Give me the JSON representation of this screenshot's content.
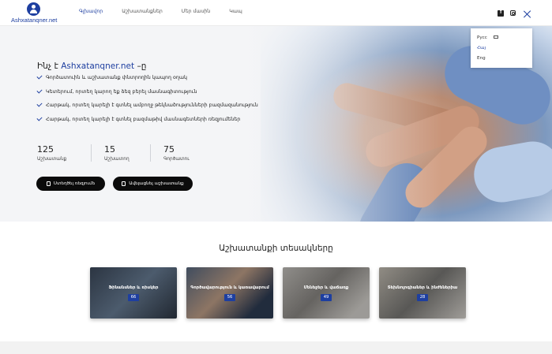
{
  "logo": {
    "text": "Ashxatanqner.net"
  },
  "nav": {
    "links": [
      "Գլխավոր",
      "Աշխատանքներ",
      "Մեր մասին",
      "Կապ"
    ]
  },
  "social": {
    "facebook": "facebook-icon",
    "instagram": "instagram-icon"
  },
  "language_menu": {
    "items": [
      "Русс",
      "Հայ",
      "Eng"
    ],
    "selected": "Հայ"
  },
  "hero": {
    "title_prefix": "Ինչ է",
    "title_brand": "Ashxatanqner.net",
    "title_suffix": "–ը",
    "features": [
      "Գործատուին և աշխատանք փնտրողին կապող օղակ",
      "Կետերում, որտեղ կարող եք ձեզ բերել մասնագիտություն",
      "Հարթակ, որտեղ կարելի է գտնել ամբողջ թեկնածությունների բազմազանություն",
      "Հարթակ, որտեղ կարելի է գտնել բազմաթիվ մասնագետների ռեզյումեներ"
    ],
    "stats": [
      {
        "value": "125",
        "label": "Աշխատանք"
      },
      {
        "value": "15",
        "label": "Աշխատող"
      },
      {
        "value": "75",
        "label": "Գործատու"
      }
    ],
    "buttons": {
      "search": "Ստեղծել ռեզյումե",
      "post": "Ավելացնել աշխատանք"
    }
  },
  "categories": {
    "title": "Աշխատանքի տեսակները",
    "items": [
      {
        "label": "Ֆինանսներ և ռիսկեր",
        "count": "66"
      },
      {
        "label": "Գործավարություն և կառավարում",
        "count": "56"
      },
      {
        "label": "Մենեջեր և վաճառք",
        "count": "49"
      },
      {
        "label": "Տեխնոլոգիաներ և ինժեներիա",
        "count": "28"
      }
    ]
  },
  "colors": {
    "accent": "#1e3fa0",
    "button": "#0b0b0b"
  }
}
